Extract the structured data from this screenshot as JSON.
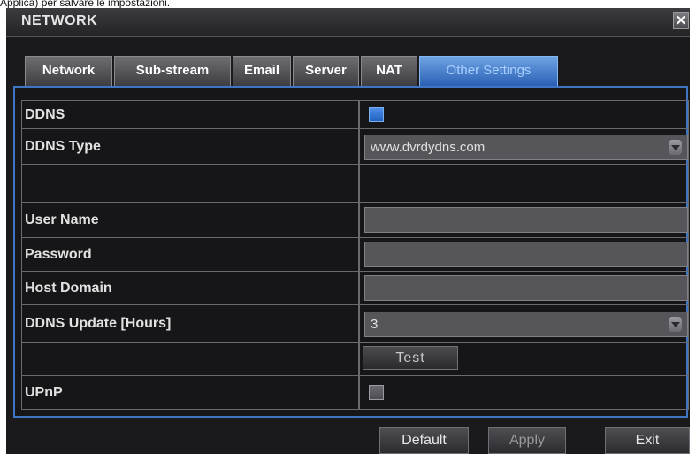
{
  "caption": "Applica) per salvare le impostazioni.",
  "window": {
    "title": "NETWORK",
    "close_glyph": "✕"
  },
  "tabs": [
    {
      "label": "Network",
      "active": false
    },
    {
      "label": "Sub-stream",
      "active": false
    },
    {
      "label": "Email",
      "active": false
    },
    {
      "label": "Server",
      "active": false
    },
    {
      "label": "NAT",
      "active": false
    },
    {
      "label": "Other Settings",
      "active": true
    }
  ],
  "settings": {
    "ddns": {
      "label": "DDNS",
      "checked": true
    },
    "ddns_type": {
      "label": "DDNS Type",
      "value": "www.dvrdydns.com"
    },
    "user_name": {
      "label": "User Name",
      "value": ""
    },
    "password": {
      "label": "Password",
      "value": ""
    },
    "host_domain": {
      "label": "Host Domain",
      "value": ""
    },
    "ddns_update": {
      "label": "DDNS Update [Hours]",
      "value": "3"
    },
    "test_button": "Test",
    "upnp": {
      "label": "UPnP",
      "checked": false
    }
  },
  "buttons": {
    "default": "Default",
    "apply": "Apply",
    "exit": "Exit"
  },
  "colors": {
    "accent": "#3f75c4",
    "active_tab": "#2a60b4",
    "background": "#1a1a1c"
  }
}
